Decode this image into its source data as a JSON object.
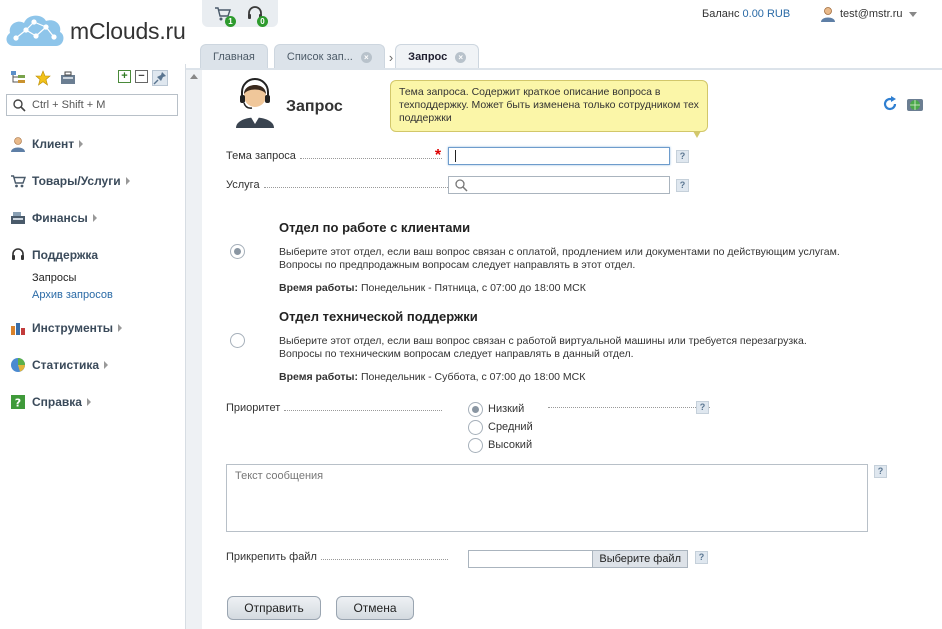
{
  "brand": {
    "name": "mClouds.ru"
  },
  "header": {
    "cart_badge": "1",
    "support_badge": "0",
    "balance_label": "Баланс",
    "balance_value": "0.00 RUB",
    "user": "test@mstr.ru"
  },
  "tabs": [
    {
      "label": "Главная"
    },
    {
      "label": "Список зап..."
    },
    {
      "label": "Запрос"
    }
  ],
  "sidebar": {
    "search_placeholder": "Ctrl + Shift + M",
    "items": [
      {
        "label": "Клиент"
      },
      {
        "label": "Товары/Услуги"
      },
      {
        "label": "Финансы"
      },
      {
        "label": "Поддержка"
      },
      {
        "label": "Инструменты"
      },
      {
        "label": "Статистика"
      },
      {
        "label": "Справка"
      }
    ],
    "support_sub": [
      {
        "label": "Запросы"
      },
      {
        "label": "Архив запросов"
      }
    ]
  },
  "page": {
    "title": "Запрос",
    "tooltip": "Тема запроса. Содержит краткое описание вопроса в техподдержку. Может быть изменена только сотрудником тех поддержки"
  },
  "form": {
    "subject_label": "Тема запроса",
    "subject_value": "",
    "service_label": "Услуга",
    "help": "?",
    "required_mark": "*",
    "departments": [
      {
        "title": "Отдел по работе с клиентами",
        "desc1": "Выберите этот отдел, если ваш вопрос связан с оплатой, продлением или документами по действующим услугам.",
        "desc2": "Вопросы по предпродажным вопросам следует направлять в этот отдел.",
        "hours_label": "Время работы:",
        "hours_value": "Понедельник - Пятница, с 07:00 до 18:00 МСК",
        "selected": true
      },
      {
        "title": "Отдел технической поддержки",
        "desc1": "Выберите этот отдел, если ваш вопрос связан с работой виртуальной машины или требуется перезагрузка.",
        "desc2": "Вопросы по техническим вопросам следует направлять в данный отдел.",
        "hours_label": "Время работы:",
        "hours_value": "Понедельник - Суббота, с 07:00 до 18:00 МСК",
        "selected": false
      }
    ],
    "priority_label": "Приоритет",
    "priority_options": [
      {
        "label": "Низкий",
        "selected": true
      },
      {
        "label": "Средний",
        "selected": false
      },
      {
        "label": "Высокий",
        "selected": false
      }
    ],
    "message_placeholder": "Текст сообщения",
    "attach_label": "Прикрепить файл",
    "attach_button": "Выберите файл",
    "submit": "Отправить",
    "cancel": "Отмена"
  }
}
